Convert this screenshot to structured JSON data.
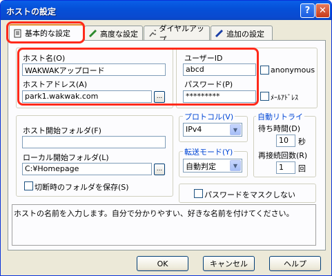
{
  "window": {
    "title": "ホストの設定",
    "help_label": "?",
    "close_label": "✕"
  },
  "tabs": [
    {
      "label": "基本的な設定",
      "icon": "notebook-icon"
    },
    {
      "label": "高度な設定",
      "icon": "pen-icon"
    },
    {
      "label": "ダイヤルアップ",
      "icon": "wrench-icon"
    },
    {
      "label": "追加の設定",
      "icon": "pencil-icon"
    }
  ],
  "basic": {
    "host_name_label": "ホスト名(O)",
    "host_name_value": "WAKWAKアップロード",
    "host_address_label": "ホストアドレス(A)",
    "host_address_value": "park1.wakwak.com",
    "browse_label": "...",
    "user_id_label": "ユーザーID",
    "user_id_value": "abcd",
    "password_label": "パスワード(P)",
    "password_value": "*********",
    "anonymous_label": "anonymous",
    "mail_address_label": "ﾒｰﾙｱﾄﾞﾚｽ",
    "host_start_folder_label": "ホスト開始フォルダ(F)",
    "host_start_folder_value": "",
    "local_start_folder_label": "ローカル開始フォルダ(L)",
    "local_start_folder_value": "C:¥Homepage",
    "save_folder_label": "切断時のフォルダを保存(S)",
    "protocol_label": "プロトコル(V)",
    "protocol_value": "IPv4",
    "transfer_mode_label": "転送モード(Y)",
    "transfer_mode_value": "自動判定",
    "auto_retry_label": "自動リトライ",
    "wait_time_label": "待ち時間(D)",
    "wait_time_value": "10",
    "wait_time_unit": "秒",
    "retry_count_label": "再接続回数(R)",
    "retry_count_value": "1",
    "retry_count_unit": "回",
    "mask_password_label": "パスワードをマスクしない",
    "description": "ホストの名前を入力します。自分で分かりやすい、好きな名前を付けてください。"
  },
  "footer": {
    "ok_label": "OK",
    "cancel_label": "キャンセル",
    "help_label": "ヘルプ"
  },
  "colors": {
    "highlight": "#ff2a1a",
    "titlebar": "#0550d8",
    "accent_blue": "#0046d5"
  }
}
